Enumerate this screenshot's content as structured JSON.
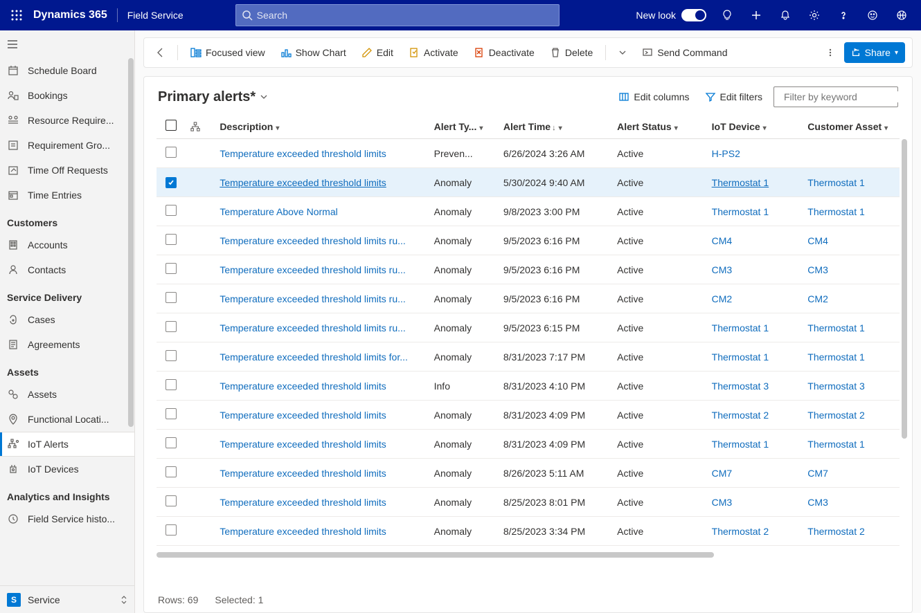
{
  "topbar": {
    "brand": "Dynamics 365",
    "app": "Field Service",
    "search_placeholder": "Search",
    "newlook_label": "New look"
  },
  "sidebar": {
    "items1": [
      {
        "label": "Schedule Board",
        "icon": "calendar"
      },
      {
        "label": "Bookings",
        "icon": "booking"
      },
      {
        "label": "Resource Require...",
        "icon": "resreq"
      },
      {
        "label": "Requirement Gro...",
        "icon": "reqgrp"
      },
      {
        "label": "Time Off Requests",
        "icon": "timeoff"
      },
      {
        "label": "Time Entries",
        "icon": "timeent"
      }
    ],
    "group_customers": "Customers",
    "items2": [
      {
        "label": "Accounts",
        "icon": "accounts"
      },
      {
        "label": "Contacts",
        "icon": "contacts"
      }
    ],
    "group_service": "Service Delivery",
    "items3": [
      {
        "label": "Cases",
        "icon": "cases"
      },
      {
        "label": "Agreements",
        "icon": "agreements"
      }
    ],
    "group_assets": "Assets",
    "items4": [
      {
        "label": "Assets",
        "icon": "assets"
      },
      {
        "label": "Functional Locati...",
        "icon": "funcloc"
      },
      {
        "label": "IoT Alerts",
        "icon": "iotalerts",
        "selected": true
      },
      {
        "label": "IoT Devices",
        "icon": "iotdev"
      }
    ],
    "group_analytics": "Analytics and Insights",
    "items5": [
      {
        "label": "Field Service histo...",
        "icon": "history"
      }
    ],
    "area_badge": "S",
    "area_label": "Service"
  },
  "cmdbar": {
    "focused": "Focused view",
    "chart": "Show Chart",
    "edit": "Edit",
    "activate": "Activate",
    "deactivate": "Deactivate",
    "delete": "Delete",
    "send": "Send Command",
    "share": "Share"
  },
  "header": {
    "title": "Primary alerts*",
    "edit_columns": "Edit columns",
    "edit_filters": "Edit filters",
    "filter_placeholder": "Filter by keyword"
  },
  "columns": {
    "description": "Description",
    "alert_type": "Alert Ty...",
    "alert_time": "Alert Time",
    "alert_status": "Alert Status",
    "iot_device": "IoT Device",
    "customer_asset": "Customer Asset"
  },
  "rows": [
    {
      "desc": "Temperature exceeded threshold limits",
      "type": "Preven...",
      "time": "6/26/2024 3:26 AM",
      "status": "Active",
      "iot": "H-PS2",
      "asset": ""
    },
    {
      "desc": "Temperature exceeded threshold limits",
      "type": "Anomaly",
      "time": "5/30/2024 9:40 AM",
      "status": "Active",
      "iot": "Thermostat 1",
      "asset": "Thermostat 1",
      "selected": true
    },
    {
      "desc": "Temperature Above Normal",
      "type": "Anomaly",
      "time": "9/8/2023 3:00 PM",
      "status": "Active",
      "iot": "Thermostat 1",
      "asset": "Thermostat 1"
    },
    {
      "desc": "Temperature exceeded threshold limits ru...",
      "type": "Anomaly",
      "time": "9/5/2023 6:16 PM",
      "status": "Active",
      "iot": "CM4",
      "asset": "CM4"
    },
    {
      "desc": "Temperature exceeded threshold limits ru...",
      "type": "Anomaly",
      "time": "9/5/2023 6:16 PM",
      "status": "Active",
      "iot": "CM3",
      "asset": "CM3"
    },
    {
      "desc": "Temperature exceeded threshold limits ru...",
      "type": "Anomaly",
      "time": "9/5/2023 6:16 PM",
      "status": "Active",
      "iot": "CM2",
      "asset": "CM2"
    },
    {
      "desc": "Temperature exceeded threshold limits ru...",
      "type": "Anomaly",
      "time": "9/5/2023 6:15 PM",
      "status": "Active",
      "iot": "Thermostat 1",
      "asset": "Thermostat 1"
    },
    {
      "desc": "Temperature exceeded threshold limits for...",
      "type": "Anomaly",
      "time": "8/31/2023 7:17 PM",
      "status": "Active",
      "iot": "Thermostat 1",
      "asset": "Thermostat 1"
    },
    {
      "desc": "Temperature exceeded threshold limits",
      "type": "Info",
      "time": "8/31/2023 4:10 PM",
      "status": "Active",
      "iot": "Thermostat 3",
      "asset": "Thermostat 3"
    },
    {
      "desc": "Temperature exceeded threshold limits",
      "type": "Anomaly",
      "time": "8/31/2023 4:09 PM",
      "status": "Active",
      "iot": "Thermostat 2",
      "asset": "Thermostat 2"
    },
    {
      "desc": "Temperature exceeded threshold limits",
      "type": "Anomaly",
      "time": "8/31/2023 4:09 PM",
      "status": "Active",
      "iot": "Thermostat 1",
      "asset": "Thermostat 1"
    },
    {
      "desc": "Temperature exceeded threshold limits",
      "type": "Anomaly",
      "time": "8/26/2023 5:11 AM",
      "status": "Active",
      "iot": "CM7",
      "asset": "CM7"
    },
    {
      "desc": "Temperature exceeded threshold limits",
      "type": "Anomaly",
      "time": "8/25/2023 8:01 PM",
      "status": "Active",
      "iot": "CM3",
      "asset": "CM3"
    },
    {
      "desc": "Temperature exceeded threshold limits",
      "type": "Anomaly",
      "time": "8/25/2023 3:34 PM",
      "status": "Active",
      "iot": "Thermostat 2",
      "asset": "Thermostat 2"
    }
  ],
  "footer": {
    "rows": "Rows: 69",
    "selected": "Selected: 1"
  }
}
